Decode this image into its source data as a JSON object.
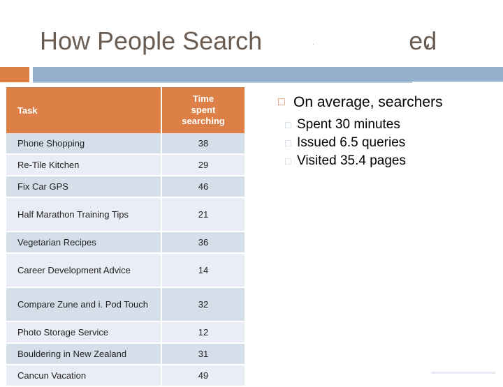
{
  "slide": {
    "title": "How People Search",
    "title_tail": "ed",
    "title_artifact_a": "e",
    "title_artifact_b": "e"
  },
  "table": {
    "columns": [
      "Task",
      "Time spent searching"
    ],
    "header_task": "Task",
    "header_time_line1": "Time",
    "header_time_line2": "spent",
    "header_time_line3": "searching",
    "rows": [
      {
        "task": "Phone Shopping",
        "time": "38"
      },
      {
        "task": "Re-Tile Kitchen",
        "time": "29"
      },
      {
        "task": "Fix Car GPS",
        "time": "46"
      },
      {
        "task": "Half Marathon Training Tips",
        "time": "21"
      },
      {
        "task": "Vegetarian Recipes",
        "time": "36"
      },
      {
        "task": "Career Development Advice",
        "time": "14"
      },
      {
        "task": "Compare Zune and i. Pod Touch",
        "time": "32"
      },
      {
        "task": "Photo Storage Service",
        "time": "12"
      },
      {
        "task": "Bouldering in New Zealand",
        "time": "31"
      },
      {
        "task": "Cancun Vacation",
        "time": "49"
      }
    ]
  },
  "content": {
    "heading": "On average, searchers",
    "heading_marker": "□",
    "sub_marker": "□",
    "sub_items": [
      "Spent 30 minutes",
      "Issued 6.5 queries",
      "Visited 35.4 pages"
    ]
  },
  "colors": {
    "accent_orange": "#dd8047",
    "accent_blue": "#94b0cd",
    "row_dark": "#d5dfea",
    "row_light": "#eaedf5",
    "title_text": "#6b5c52"
  }
}
